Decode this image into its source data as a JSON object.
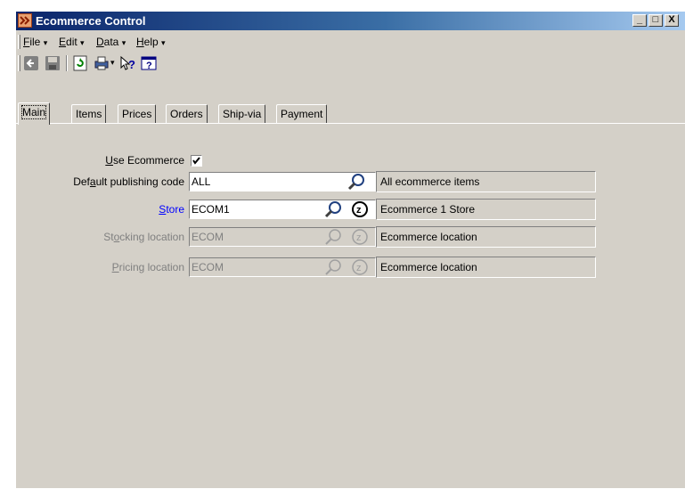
{
  "window": {
    "title": "Ecommerce Control",
    "min": "_",
    "max": "□",
    "close": "X"
  },
  "menu": [
    {
      "label": "File",
      "key": "F",
      "rest": "ile"
    },
    {
      "label": "Edit",
      "key": "E",
      "rest": "dit"
    },
    {
      "label": "Data",
      "key": "D",
      "rest": "ata"
    },
    {
      "label": "Help",
      "key": "H",
      "rest": "elp"
    }
  ],
  "menu_arrow": "▾",
  "tabs": [
    "Main",
    "Items",
    "Prices",
    "Orders",
    "Ship-via",
    "Payment"
  ],
  "form": {
    "use_ecommerce": {
      "label_key": "U",
      "label_rest": "se Ecommerce",
      "checked": true
    },
    "default_pub": {
      "label_pre": "Def",
      "label_key": "a",
      "label_post": "ult publishing code",
      "value": "ALL",
      "desc": "All ecommerce items"
    },
    "store": {
      "label_key": "S",
      "label_rest": "tore",
      "value": "ECOM1",
      "desc": "Ecommerce 1 Store"
    },
    "stocking": {
      "label_pre": "St",
      "label_key": "o",
      "label_post": "cking location",
      "value": "ECOM",
      "desc": "Ecommerce location"
    },
    "pricing": {
      "label_key": "P",
      "label_rest": "ricing location",
      "value": "ECOM",
      "desc": "Ecommerce location"
    }
  },
  "colors": {
    "title_start": "#0a246a",
    "link": "#0000ff",
    "face": "#d4d0c8"
  }
}
